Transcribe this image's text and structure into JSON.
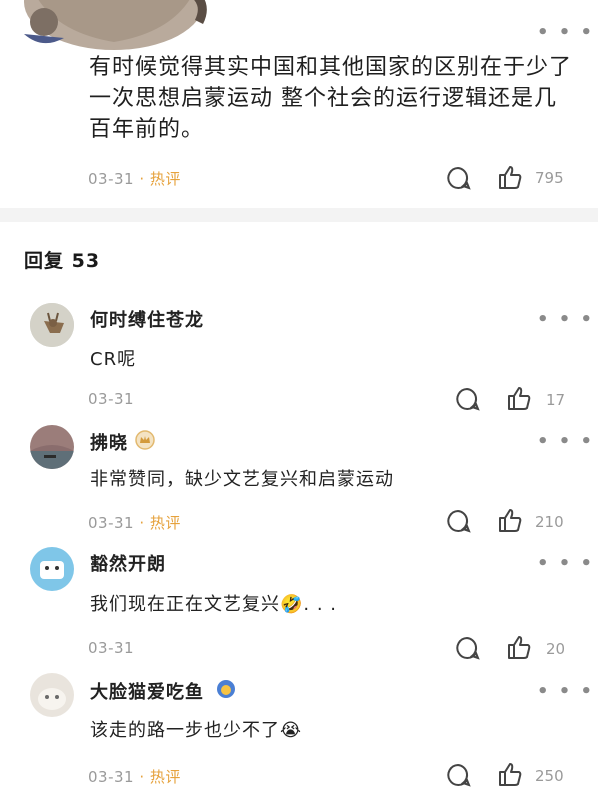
{
  "main_post": {
    "text": "有时候觉得其实中国和其他国家的区别在于少了一次思想启蒙运动 整个社会的运行逻辑还是几百年前的。",
    "date": "03-31",
    "hot_label": "· 热评",
    "like_count": "795"
  },
  "replies_header": "回复 53",
  "comments": [
    {
      "name": "何时缚住苍龙",
      "text": "CR呢",
      "date": "03-31",
      "hot_label": "",
      "likes": "17"
    },
    {
      "name": "拂晓",
      "text": "非常赞同，缺少文艺复兴和启蒙运动",
      "date": "03-31",
      "hot_label": "· 热评",
      "likes": "210"
    },
    {
      "name": "豁然开朗",
      "text": "我们现在正在文艺复兴🤣. . .",
      "date": "03-31",
      "hot_label": "",
      "likes": "20"
    },
    {
      "name": "大脸猫爱吃鱼",
      "text": "该走的路一步也少不了😭",
      "date": "03-31",
      "hot_label": "· 热评",
      "likes": "250"
    }
  ],
  "more_label": "• • •",
  "colors": {
    "hot": "#e6a23c",
    "meta": "#9a9a9a",
    "divider": "#f3f3f3"
  },
  "icons": [
    "comment-icon",
    "like-icon",
    "more-icon",
    "crown-badge-icon",
    "emoji-badge-icon"
  ]
}
